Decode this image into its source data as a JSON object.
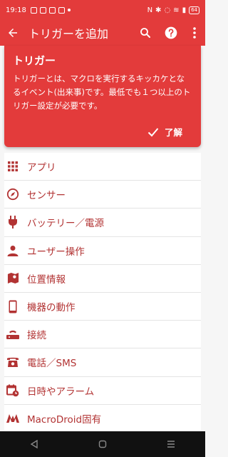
{
  "status_bar": {
    "time": "19:18",
    "battery": "64"
  },
  "toolbar": {
    "title": "トリガーを追加"
  },
  "info_card": {
    "title": "トリガー",
    "body": "トリガーとは、マクロを実行するキッカケとなるイベント(出来事)です。最低でも１つ以上のトリガー設定が必要です。",
    "ok_label": "了解"
  },
  "categories": [
    {
      "label": "アプリ",
      "icon": "grid-icon"
    },
    {
      "label": "センサー",
      "icon": "compass-icon"
    },
    {
      "label": "バッテリー／電源",
      "icon": "plug-icon"
    },
    {
      "label": "ユーザー操作",
      "icon": "person-icon"
    },
    {
      "label": "位置情報",
      "icon": "map-icon"
    },
    {
      "label": "機器の動作",
      "icon": "phone-icon"
    },
    {
      "label": "接続",
      "icon": "router-icon"
    },
    {
      "label": "電話／SMS",
      "icon": "telephone-icon"
    },
    {
      "label": "日時やアラーム",
      "icon": "calendar-clock-icon"
    },
    {
      "label": "MacroDroid固有",
      "icon": "macrodroid-icon"
    }
  ],
  "colors": {
    "primary": "#e33b3b",
    "accent_text": "#b23333"
  }
}
